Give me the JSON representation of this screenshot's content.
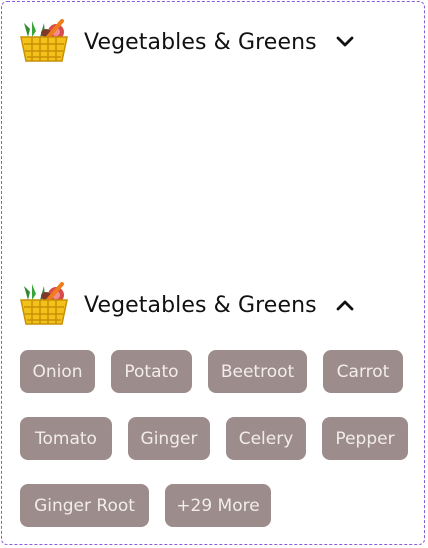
{
  "accordion": [
    {
      "title": "Vegetables & Greens",
      "state_icon": "chevron-down-icon"
    },
    {
      "title": "Vegetables & Greens",
      "state_icon": "chevron-up-icon",
      "chips": [
        "Onion",
        "Potato",
        "Beetroot",
        "Carrot",
        "Tomato",
        "Ginger",
        "Celery",
        "Pepper",
        "Ginger Root",
        "+29 More"
      ]
    }
  ],
  "colors": {
    "chip_bg": "#9d8c8c",
    "chip_text": "#f2ecec",
    "border": "#8e5bdc"
  }
}
